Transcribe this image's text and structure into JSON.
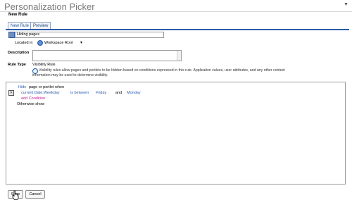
{
  "window": {
    "title": "Personalization Picker",
    "subtitle": "New Rule"
  },
  "tabs": [
    {
      "label": "New Rule",
      "active": true
    },
    {
      "label": "Preview",
      "active": false
    }
  ],
  "rule_name": {
    "value": "Hiding pages"
  },
  "location": {
    "label": "Located in",
    "value": "Workspace Root"
  },
  "description": {
    "label": "Description",
    "value": ""
  },
  "rule_type": {
    "label": "Rule Type",
    "value": "Visibility Rule",
    "help_line1": "Visibility rules allow pages and portlets to be hidden based on conditions expressed in this rule. Application values, user attributes, and any other context",
    "help_line2": "information may be used to determine visibility."
  },
  "editor": {
    "action": "Hide",
    "action_suffix": "page or portlet when",
    "condition_subject": "current Date.Weekday",
    "condition_operator": "is between",
    "condition_value1": "Friday",
    "condition_and": "and",
    "condition_value2": "Monday",
    "add_condition": "add Condition",
    "otherwise": "Otherwise show"
  },
  "buttons": {
    "save": "Save",
    "cancel": "Cancel"
  },
  "icons": [
    "rule-icon",
    "globe-icon",
    "lightbulb-icon",
    "delete-icon",
    "dropdown-arrow-icon",
    "hand-cursor-icon"
  ]
}
